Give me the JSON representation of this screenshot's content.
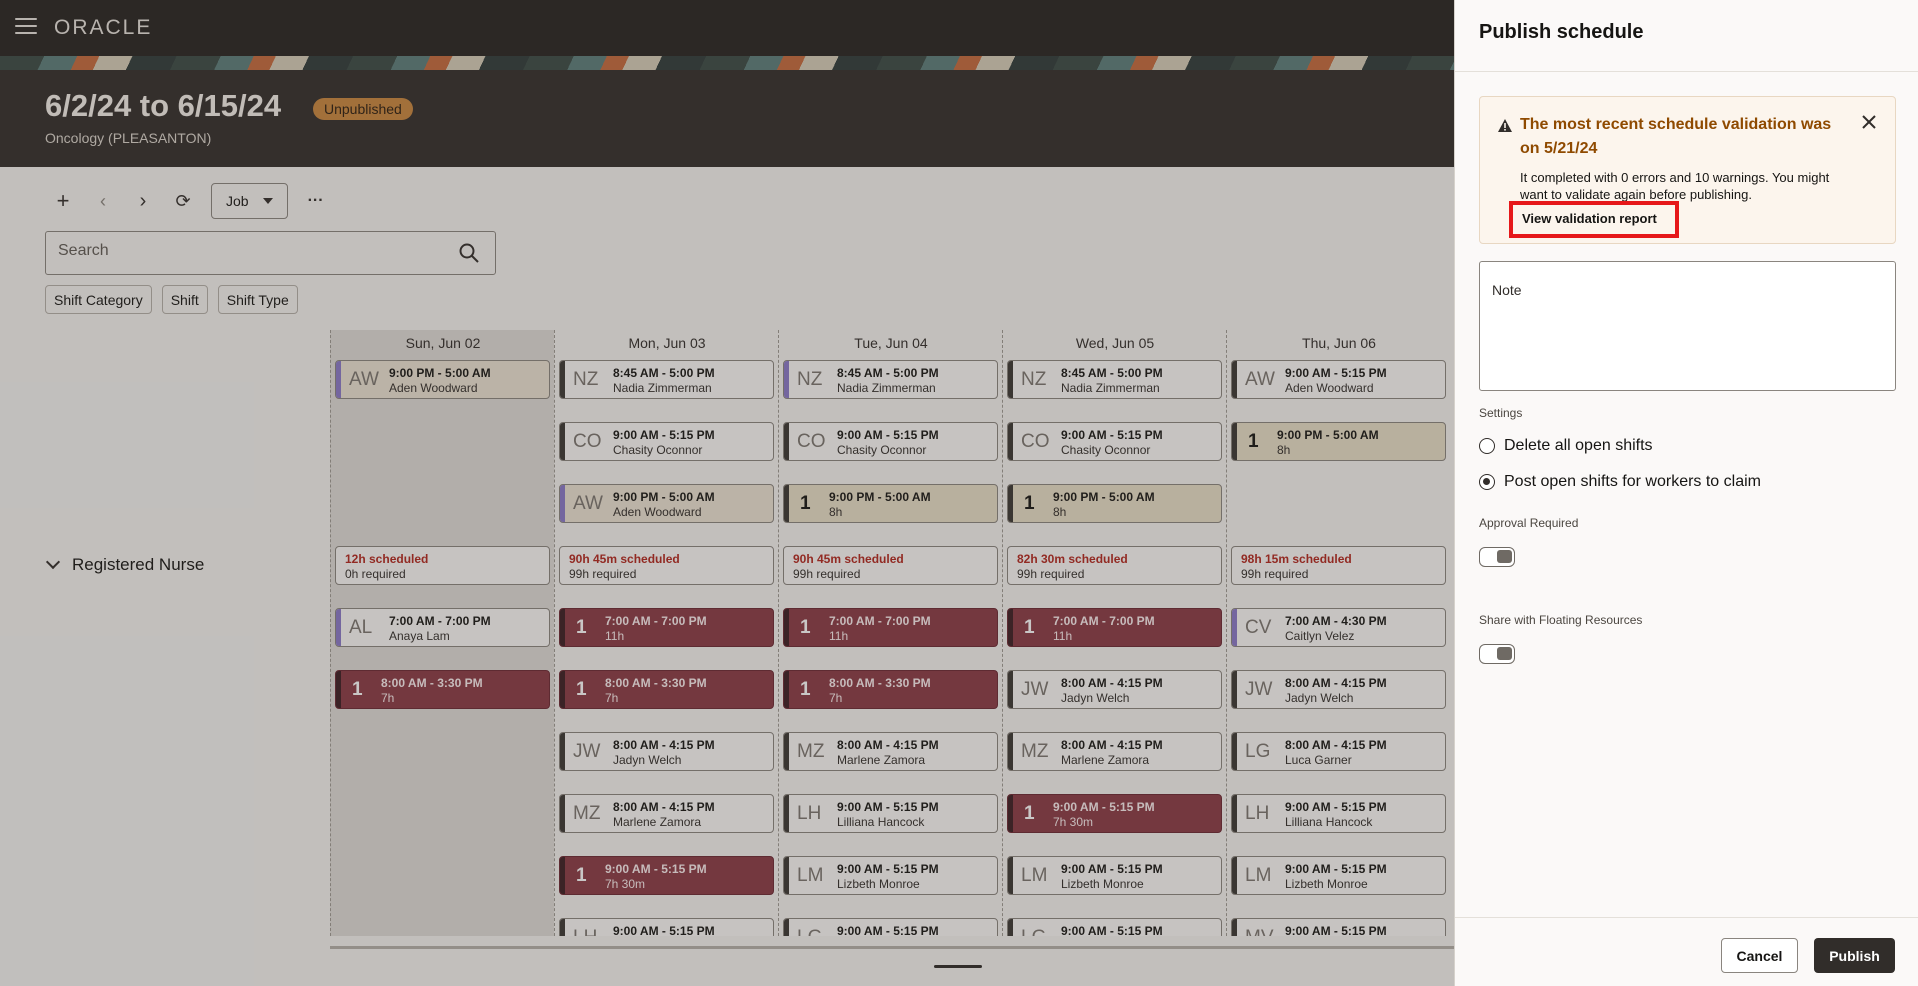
{
  "app": {
    "logo": "ORACLE"
  },
  "header": {
    "date_range": "6/2/24 to 6/15/24",
    "status": "Unpublished",
    "department": "Oncology (PLEASANTON)"
  },
  "toolbar": {
    "job_label": "Job",
    "more": "···"
  },
  "search": {
    "placeholder": "Search"
  },
  "filters": [
    "Shift Category",
    "Shift",
    "Shift Type"
  ],
  "group": {
    "label": "Registered Nurse"
  },
  "days": [
    {
      "label": "Sun, Jun 02",
      "shifts": [
        {
          "kind": "person",
          "init": "AW",
          "time": "9:00 PM - 5:00 AM",
          "sub": "Aden Woodward",
          "bar": "#8a79c9",
          "tint": "#ece4d4"
        }
      ],
      "summary": {
        "scheduled": "12h scheduled",
        "required": "0h required"
      },
      "shifts2": [
        {
          "kind": "person",
          "init": "AL",
          "time": "7:00 AM - 7:00 PM",
          "sub": "Anaya Lam",
          "bar": "#8a79c9"
        },
        {
          "kind": "dark",
          "init": "1",
          "time": "8:00 AM - 3:30 PM",
          "sub": "7h"
        }
      ]
    },
    {
      "label": "Mon, Jun 03",
      "shifts": [
        {
          "kind": "person",
          "init": "NZ",
          "time": "8:45 AM - 5:00 PM",
          "sub": "Nadia Zimmerman"
        },
        {
          "kind": "person",
          "init": "CO",
          "time": "9:00 AM - 5:15 PM",
          "sub": "Chasity Oconnor"
        },
        {
          "kind": "person",
          "init": "AW",
          "time": "9:00 PM - 5:00 AM",
          "sub": "Aden Woodward",
          "bar": "#8a79c9",
          "tint": "#ece4d4"
        }
      ],
      "summary": {
        "scheduled": "90h 45m scheduled",
        "required": "99h required"
      },
      "shifts2": [
        {
          "kind": "dark",
          "init": "1",
          "time": "7:00 AM - 7:00 PM",
          "sub": "11h"
        },
        {
          "kind": "dark",
          "init": "1",
          "time": "8:00 AM - 3:30 PM",
          "sub": "7h"
        },
        {
          "kind": "person",
          "init": "JW",
          "time": "8:00 AM - 4:15 PM",
          "sub": "Jadyn Welch"
        },
        {
          "kind": "person",
          "init": "MZ",
          "time": "8:00 AM - 4:15 PM",
          "sub": "Marlene Zamora"
        },
        {
          "kind": "dark",
          "init": "1",
          "time": "9:00 AM - 5:15 PM",
          "sub": "7h 30m"
        },
        {
          "kind": "person",
          "init": "LH",
          "time": "9:00 AM - 5:15 PM",
          "sub": ""
        }
      ]
    },
    {
      "label": "Tue, Jun 04",
      "shifts": [
        {
          "kind": "person",
          "init": "NZ",
          "time": "8:45 AM - 5:00 PM",
          "sub": "Nadia Zimmerman",
          "bar": "#8a79c9"
        },
        {
          "kind": "person",
          "init": "CO",
          "time": "9:00 AM - 5:15 PM",
          "sub": "Chasity Oconnor"
        },
        {
          "kind": "open",
          "init": "1",
          "time": "9:00 PM - 5:00 AM",
          "sub": "8h"
        }
      ],
      "summary": {
        "scheduled": "90h 45m scheduled",
        "required": "99h required"
      },
      "shifts2": [
        {
          "kind": "dark",
          "init": "1",
          "time": "7:00 AM - 7:00 PM",
          "sub": "11h"
        },
        {
          "kind": "dark",
          "init": "1",
          "time": "8:00 AM - 3:30 PM",
          "sub": "7h"
        },
        {
          "kind": "person",
          "init": "MZ",
          "time": "8:00 AM - 4:15 PM",
          "sub": "Marlene Zamora"
        },
        {
          "kind": "person",
          "init": "LH",
          "time": "9:00 AM - 5:15 PM",
          "sub": "Lilliana Hancock"
        },
        {
          "kind": "person",
          "init": "LM",
          "time": "9:00 AM - 5:15 PM",
          "sub": "Lizbeth Monroe"
        },
        {
          "kind": "person",
          "init": "LG",
          "time": "9:00 AM - 5:15 PM",
          "sub": ""
        }
      ]
    },
    {
      "label": "Wed, Jun 05",
      "shifts": [
        {
          "kind": "person",
          "init": "NZ",
          "time": "8:45 AM - 5:00 PM",
          "sub": "Nadia Zimmerman"
        },
        {
          "kind": "person",
          "init": "CO",
          "time": "9:00 AM - 5:15 PM",
          "sub": "Chasity Oconnor"
        },
        {
          "kind": "open",
          "init": "1",
          "time": "9:00 PM - 5:00 AM",
          "sub": "8h"
        }
      ],
      "summary": {
        "scheduled": "82h 30m scheduled",
        "required": "99h required"
      },
      "shifts2": [
        {
          "kind": "dark",
          "init": "1",
          "time": "7:00 AM - 7:00 PM",
          "sub": "11h"
        },
        {
          "kind": "person",
          "init": "JW",
          "time": "8:00 AM - 4:15 PM",
          "sub": "Jadyn Welch"
        },
        {
          "kind": "person",
          "init": "MZ",
          "time": "8:00 AM - 4:15 PM",
          "sub": "Marlene Zamora"
        },
        {
          "kind": "dark",
          "init": "1",
          "time": "9:00 AM - 5:15 PM",
          "sub": "7h 30m"
        },
        {
          "kind": "person",
          "init": "LM",
          "time": "9:00 AM - 5:15 PM",
          "sub": "Lizbeth Monroe"
        },
        {
          "kind": "person",
          "init": "LG",
          "time": "9:00 AM - 5:15 PM",
          "sub": ""
        }
      ]
    },
    {
      "label": "Thu, Jun 06",
      "shifts": [
        {
          "kind": "person",
          "init": "AW",
          "time": "9:00 AM - 5:15 PM",
          "sub": "Aden Woodward"
        },
        {
          "kind": "open",
          "init": "1",
          "time": "9:00 PM - 5:00 AM",
          "sub": "8h"
        },
        null
      ],
      "summary": {
        "scheduled": "98h 15m scheduled",
        "required": "99h required"
      },
      "shifts2": [
        {
          "kind": "person",
          "init": "CV",
          "time": "7:00 AM - 4:30 PM",
          "sub": "Caitlyn Velez",
          "bar": "#8a79c9"
        },
        {
          "kind": "person",
          "init": "JW",
          "time": "8:00 AM - 4:15 PM",
          "sub": "Jadyn Welch"
        },
        {
          "kind": "person",
          "init": "LG",
          "time": "8:00 AM - 4:15 PM",
          "sub": "Luca Garner"
        },
        {
          "kind": "person",
          "init": "LH",
          "time": "9:00 AM - 5:15 PM",
          "sub": "Lilliana Hancock"
        },
        {
          "kind": "person",
          "init": "LM",
          "time": "9:00 AM - 5:15 PM",
          "sub": "Lizbeth Monroe"
        },
        {
          "kind": "person",
          "init": "MV",
          "time": "9:00 AM - 5:15 PM",
          "sub": ""
        }
      ]
    }
  ],
  "drawer": {
    "title": "Publish schedule",
    "alert": {
      "title": "The most recent schedule validation was on 5/21/24",
      "body": "It completed with 0 errors and 10 warnings. You might want to validate again before publishing.",
      "link": "View validation report"
    },
    "note": {
      "label": "Note",
      "value": ""
    },
    "settings_label": "Settings",
    "options": [
      {
        "label": "Delete all open shifts",
        "selected": false
      },
      {
        "label": "Post open shifts for workers to claim",
        "selected": true
      }
    ],
    "approval_label": "Approval Required",
    "approval_on": false,
    "floating_label": "Share with Floating Resources",
    "floating_on": false,
    "cancel": "Cancel",
    "publish": "Publish"
  },
  "colors": {
    "accent_dark": "#312d2a",
    "warning": "#8f4a00",
    "open_shift": "#8a3a45",
    "pill": "#c9873e",
    "highlight": "#e6181a"
  }
}
